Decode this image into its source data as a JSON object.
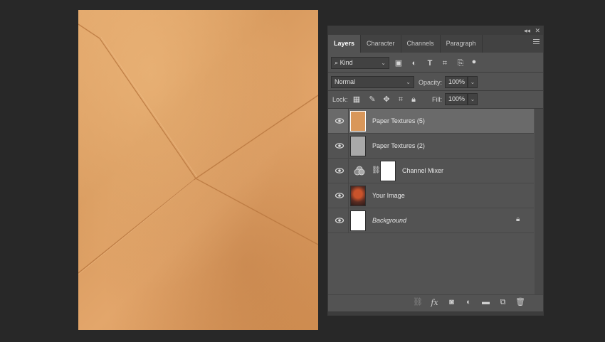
{
  "canvas": {
    "description_icon": "paper-texture-image"
  },
  "panel": {
    "collapse_icon": "double-chevron-left-icon",
    "close_icon": "close-icon",
    "tabs": [
      {
        "label": "Layers",
        "active": true
      },
      {
        "label": "Character",
        "active": false
      },
      {
        "label": "Channels",
        "active": false
      },
      {
        "label": "Paragraph",
        "active": false
      }
    ],
    "filter": {
      "label": "Kind",
      "icons": [
        "image-filter-icon",
        "adjustment-filter-icon",
        "type-filter-icon",
        "shape-filter-icon",
        "smart-object-filter-icon",
        "filter-toggle-icon"
      ]
    },
    "blend_mode": "Normal",
    "opacity_label": "Opacity:",
    "opacity_value": "100%",
    "lock_label": "Lock:",
    "fill_label": "Fill:",
    "fill_value": "100%",
    "layers": [
      {
        "name": "Paper Textures (5)",
        "selected": true,
        "thumb": "#d9975a"
      },
      {
        "name": "Paper Textures (2)",
        "selected": false,
        "thumb": "#a9a9a9"
      },
      {
        "name": "Channel Mixer",
        "selected": false,
        "thumb": "#ffffff",
        "adjustment": true
      },
      {
        "name": "Your Image",
        "selected": false,
        "thumb": "#6b3a2a"
      },
      {
        "name": "Background",
        "selected": false,
        "thumb": "#ffffff",
        "italic": true,
        "locked": true
      }
    ],
    "bottom_icons": [
      "link-layers-icon",
      "fx-icon",
      "layer-mask-icon",
      "adjustment-layer-icon",
      "group-folder-icon",
      "new-layer-icon",
      "trash-icon"
    ]
  },
  "colors": {
    "panel_bg": "#535353",
    "selected_row": "#6a6a6a",
    "background": "#282828"
  }
}
